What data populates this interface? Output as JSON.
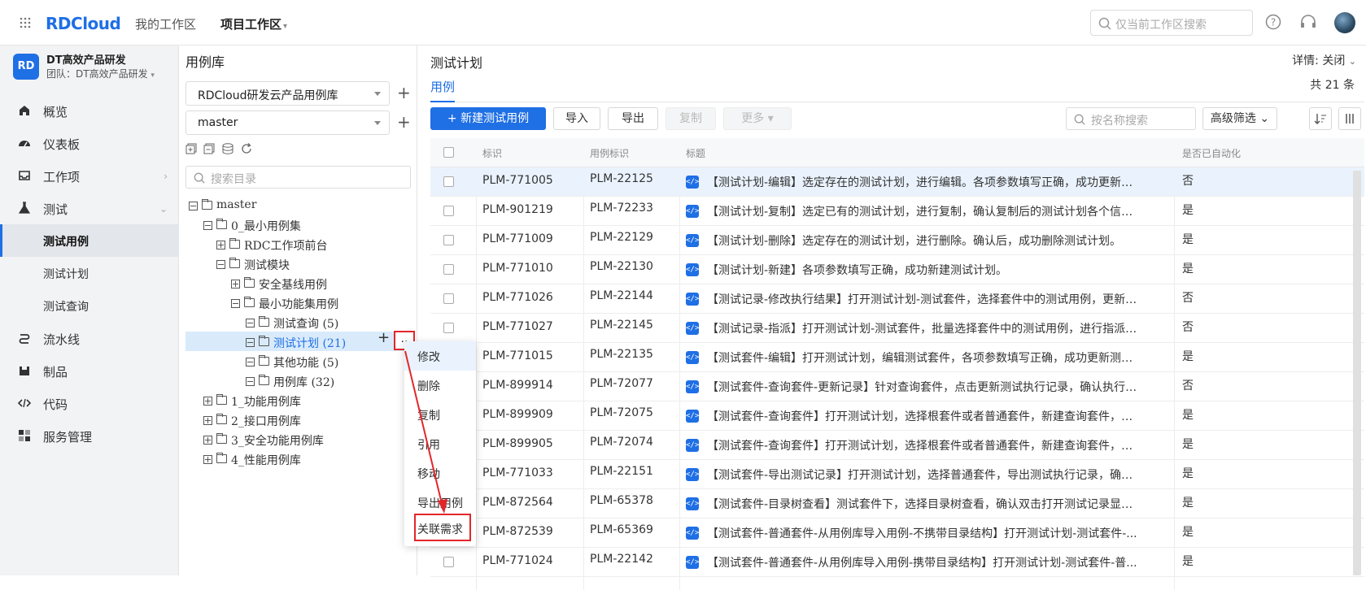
{
  "topbar": {
    "logo_rd": "RD",
    "logo_cloud": "Cloud",
    "tab_my": "我的工作区",
    "tab_project": "项目工作区",
    "search_placeholder": "仅当前工作区搜索"
  },
  "team": {
    "logo": "RD",
    "name": "DT高效产品研发",
    "sub": "团队：DT高效产品研发"
  },
  "sidebar": {
    "items": [
      {
        "label": "概览",
        "icon": "home-icon"
      },
      {
        "label": "仪表板",
        "icon": "dashboard-icon"
      },
      {
        "label": "工作项",
        "icon": "inbox-icon"
      },
      {
        "label": "测试",
        "icon": "flask-icon"
      },
      {
        "label": "测试用例",
        "icon": ""
      },
      {
        "label": "测试计划",
        "icon": ""
      },
      {
        "label": "测试查询",
        "icon": ""
      },
      {
        "label": "流水线",
        "icon": "pipeline-icon"
      },
      {
        "label": "制品",
        "icon": "package-icon"
      },
      {
        "label": "代码",
        "icon": "code-icon"
      },
      {
        "label": "服务管理",
        "icon": "service-icon"
      }
    ]
  },
  "library": {
    "title": "用例库",
    "repo": "RDCloud研发云产品用例库",
    "branch": "master",
    "search_placeholder": "搜索目录",
    "tree": [
      "master",
      "0_最小用例集",
      "RDC工作项前台",
      "测试模块",
      "安全基线用例",
      "最小功能集用例",
      "测试查询 (5)",
      "测试计划 (21)",
      "其他功能 (5)",
      "用例库 (32)",
      "1_功能用例库",
      "2_接口用例库",
      "3_安全功能用例库",
      "4_性能用例库"
    ],
    "more_label": ".."
  },
  "context_menu": [
    "修改",
    "删除",
    "复制",
    "引用",
    "移动",
    "导出用例",
    "关联需求"
  ],
  "main": {
    "title": "测试计划",
    "detail": "详情: 关闭",
    "tab": "用例",
    "count": "共 21 条",
    "buttons": {
      "new": "+ 新建测试用例",
      "import": "导入",
      "export": "导出",
      "copy": "复制",
      "more": "更多 ▾",
      "filter": "高级筛选 ⌄"
    },
    "name_search_placeholder": "按名称搜索",
    "columns": [
      "标识",
      "用例标识",
      "标题",
      "是否已自动化"
    ],
    "rows": [
      [
        "PLM-771005",
        "PLM-22125",
        "【测试计划-编辑】选定存在的测试计划，进行编辑。各项参数填写正确，成功更新测...",
        "否"
      ],
      [
        "PLM-901219",
        "PLM-72233",
        "【测试计划-复制】选定已有的测试计划，进行复制，确认复制后的测试计划各个信息...",
        "是"
      ],
      [
        "PLM-771009",
        "PLM-22129",
        "【测试计划-删除】选定存在的测试计划，进行删除。确认后，成功删除测试计划。",
        "是"
      ],
      [
        "PLM-771010",
        "PLM-22130",
        "【测试计划-新建】各项参数填写正确，成功新建测试计划。",
        "是"
      ],
      [
        "PLM-771026",
        "PLM-22144",
        "【测试记录-修改执行结果】打开测试计划-测试套件，选择套件中的测试用例，更新执...",
        "否"
      ],
      [
        "PLM-771027",
        "PLM-22145",
        "【测试记录-指派】打开测试计划-测试套件，批量选择套件中的测试用例，进行指派。...",
        "否"
      ],
      [
        "PLM-771015",
        "PLM-22135",
        "【测试套件-编辑】打开测试计划，编辑测试套件，各项参数填写正确，成功更新测试...",
        "是"
      ],
      [
        "PLM-899914",
        "PLM-72077",
        "【测试套件-查询套件-更新记录】针对查询套件，点击更新测试执行记录，确认执行记...",
        "否"
      ],
      [
        "PLM-899909",
        "PLM-72075",
        "【测试套件-查询套件】打开测试计划，选择根套件或者普通套件，新建查询套件，新...",
        "是"
      ],
      [
        "PLM-899905",
        "PLM-72074",
        "【测试套件-查询套件】打开测试计划，选择根套件或者普通套件，新建查询套件，选...",
        "是"
      ],
      [
        "PLM-771033",
        "PLM-22151",
        "【测试套件-导出测试记录】打开测试计划，选择普通套件，导出测试执行记录，确认...",
        "是"
      ],
      [
        "PLM-872564",
        "PLM-65378",
        "【测试套件-目录树查看】测试套件下，选择目录树查看，确认双击打开测试记录显示...",
        "是"
      ],
      [
        "PLM-872539",
        "PLM-65369",
        "【测试套件-普通套件-从用例库导入用例-不携带目录结构】打开测试计划-测试套件-...",
        "是"
      ],
      [
        "PLM-771024",
        "PLM-22142",
        "【测试套件-普通套件-从用例库导入用例-携带目录结构】打开测试计划-测试套件-普...",
        "是"
      ]
    ]
  },
  "colors": {
    "accent": "#1f6fe5",
    "highlight": "#e3262a"
  }
}
